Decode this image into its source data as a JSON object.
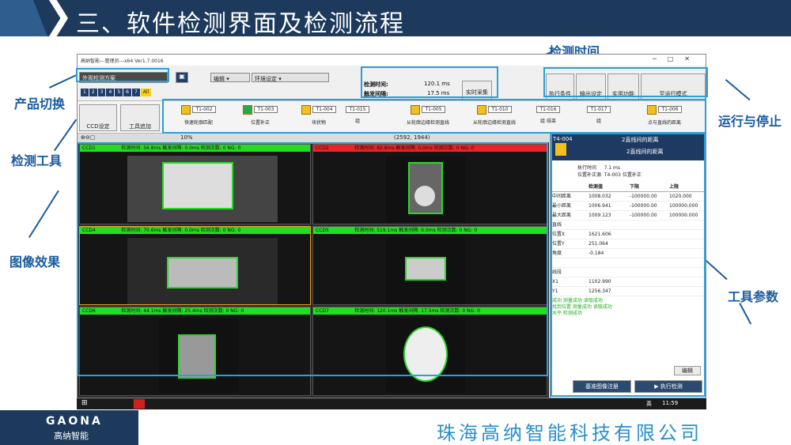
{
  "slide_title": "三、软件检测界面及检测流程",
  "annotations": {
    "product_switch": "产品切换",
    "detect_tools": "检测工具",
    "image_effect": "图像效果",
    "detect_time": "检测时间",
    "run_stop": "运行与停止",
    "tool_params": "工具参数"
  },
  "app": {
    "window_title": "高纳智能---管理员---x64 Ver1.7.0016",
    "product_combo": "外观检测方案",
    "edit_menu": "编辑",
    "env_menu": "环境设定",
    "tabs": [
      "1",
      "2",
      "3",
      "4",
      "5",
      "6",
      "7",
      "All"
    ],
    "detect_time_label": "检测时间:",
    "detect_time_value": "120.1 ms",
    "trigger_label": "触发间隔:",
    "trigger_value": "17.5 ms",
    "realtime_btn": "实时采集",
    "toolbar": [
      "执行条件",
      "输出设定",
      "实用功能",
      "至运行模式"
    ],
    "ccd_set": "CCD设定",
    "tool_add": "工具追加",
    "tools": [
      {
        "id": "T1-002",
        "name": "快速轮廓匹配"
      },
      {
        "id": "T1-003",
        "name": "位置补正"
      },
      {
        "id": "T1-004",
        "name": "块状物"
      },
      {
        "id": "T1-015",
        "name": "组"
      },
      {
        "id": "T1-005",
        "name": "从轮廓边缘检测直线"
      },
      {
        "id": "T1-010",
        "name": "从轮廓边缘检测直线"
      },
      {
        "id": "T1-016",
        "name": "组 结束"
      },
      {
        "id": "T1-017",
        "name": "组"
      },
      {
        "id": "T1-006",
        "name": "点与直线的距离"
      }
    ],
    "zoom": "10%",
    "coords": "(2592, 1944)",
    "ccds": [
      {
        "name": "CCD1",
        "stats": "检测时间: 56.8ms 触发间隔: 0.0ms 检测次数: 0 NG: 0",
        "ok": true
      },
      {
        "name": "CCD2",
        "stats": "检测时间: 82.8ms 触发间隔: 0.0ms 检测次数: 0 NG: 0",
        "ok": false
      },
      {
        "name": "CCD4",
        "stats": "检测时间: 70.6ms 触发间隔: 0.0ms 检测次数: 0 NG: 0",
        "ok": true
      },
      {
        "name": "CCD5",
        "stats": "检测时间: 519.1ms 触发间隔: 0.0ms 检测次数: 0 NG: 0",
        "ok": true
      },
      {
        "name": "CCD6",
        "stats": "检测时间: 44.1ms 触发间隔: 25.4ms 检测次数: 0 NG: 0",
        "ok": true
      },
      {
        "name": "CCD7",
        "stats": "检测时间: 120.1ms 触发间隔: 17.5ms 检测次数: 0 NG: 0",
        "ok": true
      }
    ],
    "panel": {
      "tool_id": "T4-004",
      "tool_title": "2直线间的距离",
      "tool_subtitle": "2直线间的距离",
      "exec_time_label": "执行时间",
      "exec_time_value": "7.1",
      "exec_time_unit": "ms",
      "ref_label": "位置补正源",
      "ref_value": "T4-003 位置补正",
      "col_headers": [
        "",
        "检测值",
        "下限",
        "上限"
      ],
      "rows": [
        [
          "中间距离",
          "1008.032",
          "-100000.00",
          "1020.000"
        ],
        [
          "最小距离",
          "1006.941",
          "-100000.00",
          "100000.000"
        ],
        [
          "最大距离",
          "1009.123",
          "-100000.00",
          "100000.000"
        ],
        [
          "直线",
          "",
          "",
          ""
        ],
        [
          "位置X",
          "1621.606",
          "",
          ""
        ],
        [
          "位置Y",
          "251.064",
          "",
          ""
        ],
        [
          "角度",
          "-0.184",
          "",
          ""
        ],
        [
          "",
          "",
          "",
          ""
        ],
        [
          "线段",
          "",
          "",
          ""
        ],
        [
          "X1",
          "1102.990",
          "",
          ""
        ],
        [
          "Y1",
          "1256.347",
          "",
          ""
        ]
      ],
      "log": [
        "成功 测量成功 读取成功",
        "找到位置 测量成功 读取成功",
        "水平 检测成功"
      ],
      "edit_btn": "编辑",
      "register_btn": "基准图像注册",
      "run_btn": "执行检测"
    },
    "clock": "11:59",
    "ime": "英"
  },
  "footer": {
    "logo": "GAONA",
    "logo_cn": "高纳智能",
    "company": "珠海高纳智能科技有限公司"
  },
  "colors": {
    "accent": "#1a5aa0",
    "highlight": "#2aa0d8",
    "ok": "#22dd22",
    "ng": "#ee2222",
    "navy": "#1d3a5c"
  }
}
